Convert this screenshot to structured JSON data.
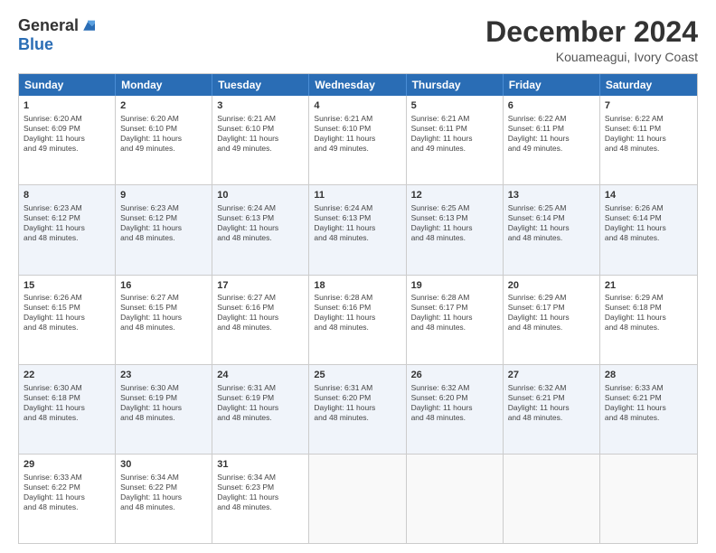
{
  "logo": {
    "general": "General",
    "blue": "Blue"
  },
  "header": {
    "month": "December 2024",
    "location": "Kouameagui, Ivory Coast"
  },
  "days": [
    "Sunday",
    "Monday",
    "Tuesday",
    "Wednesday",
    "Thursday",
    "Friday",
    "Saturday"
  ],
  "rows": [
    [
      {
        "day": "1",
        "sunrise": "6:20 AM",
        "sunset": "6:09 PM",
        "daylight": "11 hours and 49 minutes."
      },
      {
        "day": "2",
        "sunrise": "6:20 AM",
        "sunset": "6:10 PM",
        "daylight": "11 hours and 49 minutes."
      },
      {
        "day": "3",
        "sunrise": "6:21 AM",
        "sunset": "6:10 PM",
        "daylight": "11 hours and 49 minutes."
      },
      {
        "day": "4",
        "sunrise": "6:21 AM",
        "sunset": "6:10 PM",
        "daylight": "11 hours and 49 minutes."
      },
      {
        "day": "5",
        "sunrise": "6:21 AM",
        "sunset": "6:11 PM",
        "daylight": "11 hours and 49 minutes."
      },
      {
        "day": "6",
        "sunrise": "6:22 AM",
        "sunset": "6:11 PM",
        "daylight": "11 hours and 49 minutes."
      },
      {
        "day": "7",
        "sunrise": "6:22 AM",
        "sunset": "6:11 PM",
        "daylight": "11 hours and 48 minutes."
      }
    ],
    [
      {
        "day": "8",
        "sunrise": "6:23 AM",
        "sunset": "6:12 PM",
        "daylight": "11 hours and 48 minutes."
      },
      {
        "day": "9",
        "sunrise": "6:23 AM",
        "sunset": "6:12 PM",
        "daylight": "11 hours and 48 minutes."
      },
      {
        "day": "10",
        "sunrise": "6:24 AM",
        "sunset": "6:13 PM",
        "daylight": "11 hours and 48 minutes."
      },
      {
        "day": "11",
        "sunrise": "6:24 AM",
        "sunset": "6:13 PM",
        "daylight": "11 hours and 48 minutes."
      },
      {
        "day": "12",
        "sunrise": "6:25 AM",
        "sunset": "6:13 PM",
        "daylight": "11 hours and 48 minutes."
      },
      {
        "day": "13",
        "sunrise": "6:25 AM",
        "sunset": "6:14 PM",
        "daylight": "11 hours and 48 minutes."
      },
      {
        "day": "14",
        "sunrise": "6:26 AM",
        "sunset": "6:14 PM",
        "daylight": "11 hours and 48 minutes."
      }
    ],
    [
      {
        "day": "15",
        "sunrise": "6:26 AM",
        "sunset": "6:15 PM",
        "daylight": "11 hours and 48 minutes."
      },
      {
        "day": "16",
        "sunrise": "6:27 AM",
        "sunset": "6:15 PM",
        "daylight": "11 hours and 48 minutes."
      },
      {
        "day": "17",
        "sunrise": "6:27 AM",
        "sunset": "6:16 PM",
        "daylight": "11 hours and 48 minutes."
      },
      {
        "day": "18",
        "sunrise": "6:28 AM",
        "sunset": "6:16 PM",
        "daylight": "11 hours and 48 minutes."
      },
      {
        "day": "19",
        "sunrise": "6:28 AM",
        "sunset": "6:17 PM",
        "daylight": "11 hours and 48 minutes."
      },
      {
        "day": "20",
        "sunrise": "6:29 AM",
        "sunset": "6:17 PM",
        "daylight": "11 hours and 48 minutes."
      },
      {
        "day": "21",
        "sunrise": "6:29 AM",
        "sunset": "6:18 PM",
        "daylight": "11 hours and 48 minutes."
      }
    ],
    [
      {
        "day": "22",
        "sunrise": "6:30 AM",
        "sunset": "6:18 PM",
        "daylight": "11 hours and 48 minutes."
      },
      {
        "day": "23",
        "sunrise": "6:30 AM",
        "sunset": "6:19 PM",
        "daylight": "11 hours and 48 minutes."
      },
      {
        "day": "24",
        "sunrise": "6:31 AM",
        "sunset": "6:19 PM",
        "daylight": "11 hours and 48 minutes."
      },
      {
        "day": "25",
        "sunrise": "6:31 AM",
        "sunset": "6:20 PM",
        "daylight": "11 hours and 48 minutes."
      },
      {
        "day": "26",
        "sunrise": "6:32 AM",
        "sunset": "6:20 PM",
        "daylight": "11 hours and 48 minutes."
      },
      {
        "day": "27",
        "sunrise": "6:32 AM",
        "sunset": "6:21 PM",
        "daylight": "11 hours and 48 minutes."
      },
      {
        "day": "28",
        "sunrise": "6:33 AM",
        "sunset": "6:21 PM",
        "daylight": "11 hours and 48 minutes."
      }
    ],
    [
      {
        "day": "29",
        "sunrise": "6:33 AM",
        "sunset": "6:22 PM",
        "daylight": "11 hours and 48 minutes."
      },
      {
        "day": "30",
        "sunrise": "6:34 AM",
        "sunset": "6:22 PM",
        "daylight": "11 hours and 48 minutes."
      },
      {
        "day": "31",
        "sunrise": "6:34 AM",
        "sunset": "6:23 PM",
        "daylight": "11 hours and 48 minutes."
      },
      null,
      null,
      null,
      null
    ]
  ],
  "labels": {
    "sunrise": "Sunrise: ",
    "sunset": "Sunset: ",
    "daylight": "Daylight: "
  }
}
